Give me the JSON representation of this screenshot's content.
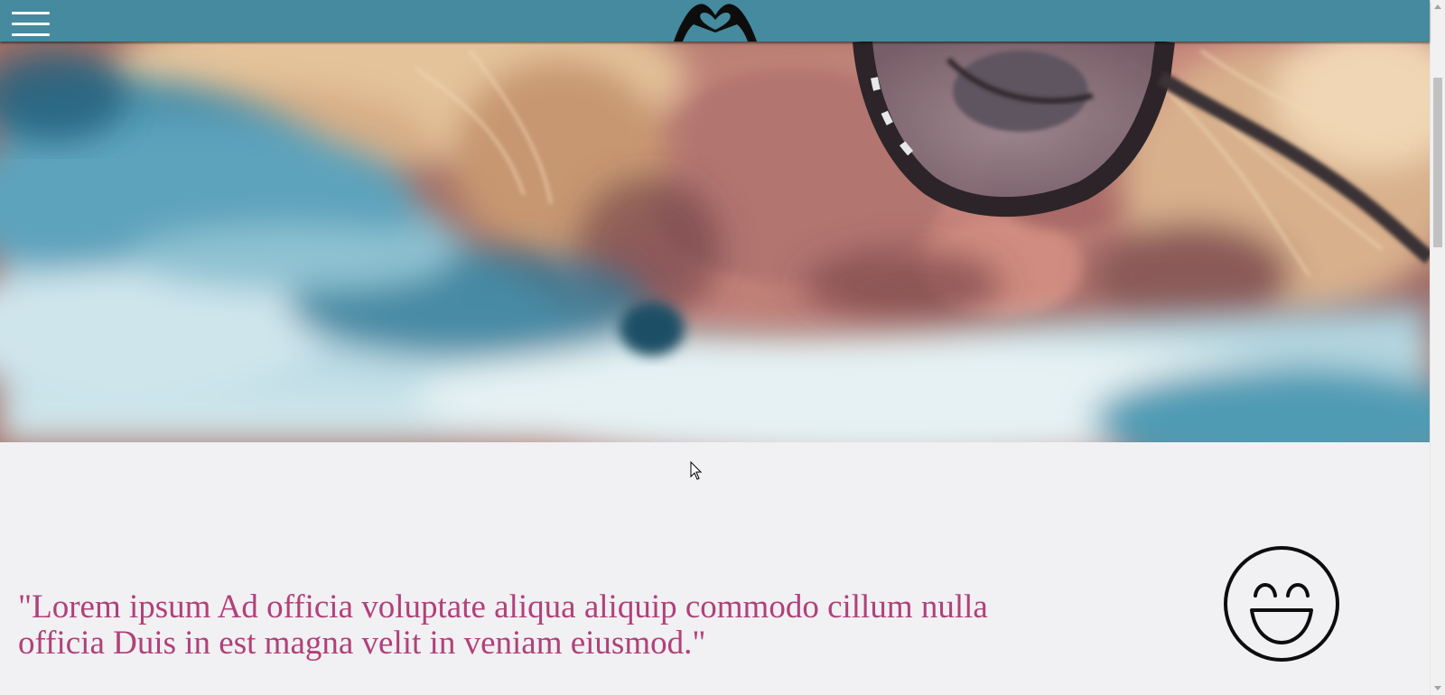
{
  "header": {
    "background": "#458a9e",
    "menu_icon": "hamburger-menu-icon",
    "logo_icon": "heart-hands-logo-icon"
  },
  "hero": {
    "image": "close-up-of-woman-with-glasses-and-blond-hair-under-blanket"
  },
  "content": {
    "quote": "\"Lorem ipsum Ad officia voluptate aliqua aliquip commodo cillum nulla officia Duis in est magna velit in veniam eiusmod.\"",
    "quote_color": "#b0417a",
    "icon": "smiley-face-icon"
  }
}
